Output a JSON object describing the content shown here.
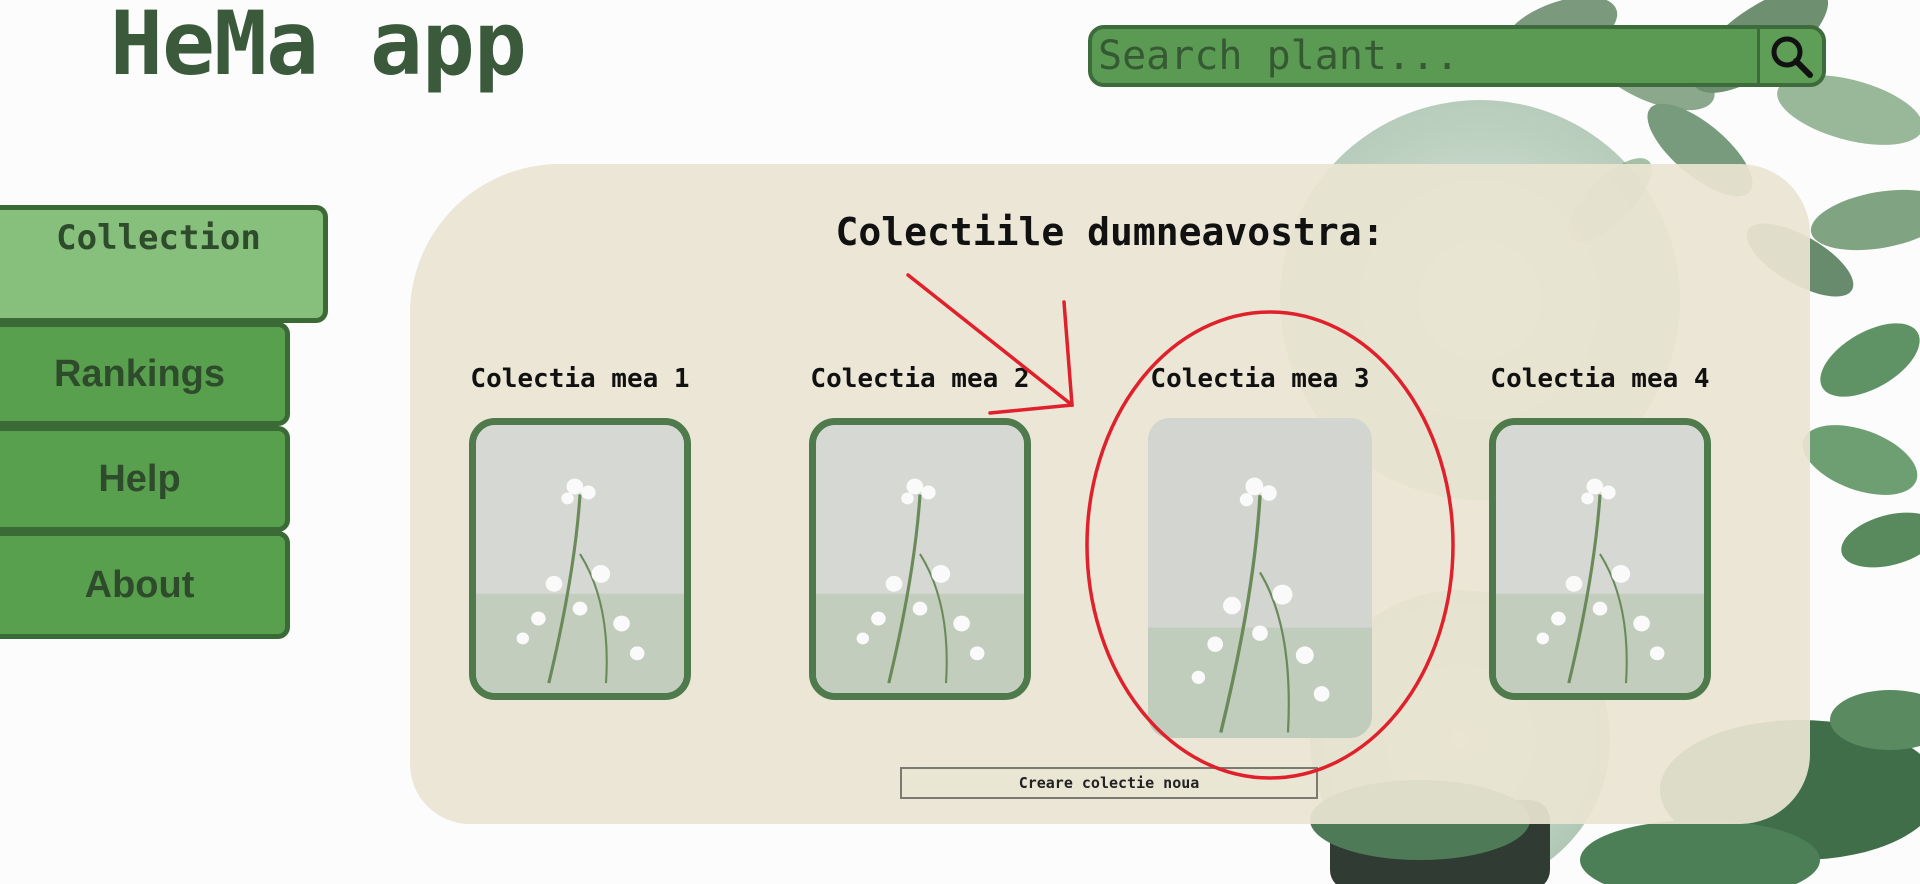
{
  "header": {
    "app_title": "HeMa app",
    "search_placeholder": "Search plant...",
    "search_icon": "search-icon"
  },
  "sidebar": {
    "items": [
      {
        "label": "Collection",
        "active": true
      },
      {
        "label": "Rankings",
        "active": false
      },
      {
        "label": "Help",
        "active": false
      },
      {
        "label": "About",
        "active": false
      }
    ]
  },
  "main": {
    "heading": "Colectiile dumneavostra:",
    "collections": [
      {
        "title": "Colectia mea 1"
      },
      {
        "title": "Colectia mea 2"
      },
      {
        "title": "Colectia mea 3",
        "highlighted": true
      },
      {
        "title": "Colectia mea 4"
      }
    ],
    "create_button_label": "Creare colectie noua"
  },
  "colors": {
    "accent_green": "#59a04e",
    "dark_green": "#3a6a36",
    "active_green": "#86c07c",
    "panel_bg": "#e9e4d2",
    "annotation_red": "#e0202a"
  }
}
